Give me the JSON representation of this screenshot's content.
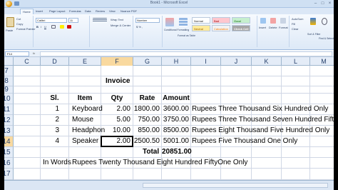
{
  "window": {
    "title": "Book1 - Microsoft Excel"
  },
  "tabs": [
    "Home",
    "Insert",
    "Page Layout",
    "Formulas",
    "Data",
    "Review",
    "View",
    "Nuance PDF"
  ],
  "ribbon": {
    "clipboard": {
      "cut": "Cut",
      "copy": "Copy",
      "format_painter": "Format Painter",
      "paste": "Paste"
    },
    "font": {
      "name": "Calibri",
      "size": "11"
    },
    "alignment": {
      "wrap": "Wrap Text",
      "merge": "Merge & Center"
    },
    "number": {
      "format": "Number"
    },
    "styles": {
      "conditional": "Conditional Formatting",
      "format_table": "Format as Table",
      "normal": "Normal",
      "bad": "Bad",
      "good": "Good",
      "neutral": "Neutral",
      "calculation": "Calculation",
      "check_cell": "Check Cell"
    },
    "cells": {
      "insert": "Insert",
      "delete": "Delete",
      "format": "Format"
    },
    "editing": {
      "autosum": "AutoSum",
      "fill": "Fill",
      "clear": "Clear",
      "sort": "Sort & Filter",
      "find": "Find & Select"
    }
  },
  "formula_bar": {
    "name_box": "F14",
    "fx": "fx"
  },
  "columns": [
    "C",
    "D",
    "E",
    "F",
    "G",
    "H",
    "I",
    "J",
    "K",
    "L",
    "M"
  ],
  "rows": [
    "7",
    "8",
    "9",
    "10",
    "11",
    "12",
    "13",
    "14",
    "15",
    "16",
    "17"
  ],
  "sheet": {
    "title": "Invoice",
    "headers": {
      "sl": "Sl.",
      "item": "Item",
      "qty": "Qty",
      "rate": "Rate",
      "amount": "Amount"
    },
    "items": [
      {
        "sl": "1",
        "item": "Keyboard",
        "qty": "2.00",
        "rate": "1800.00",
        "amount": "3600.00",
        "words": "Rupees Three Thousand Six Hundred  Only"
      },
      {
        "sl": "2",
        "item": "Mouse",
        "qty": "5.00",
        "rate": "750.00",
        "amount": "3750.00",
        "words": "Rupees Three Thousand Seven Hundred Fifty Only"
      },
      {
        "sl": "3",
        "item": "Headphon",
        "qty": "10.00",
        "rate": "850.00",
        "amount": "8500.00",
        "words": "Rupees Eight Thousand Five Hundred  Only"
      },
      {
        "sl": "4",
        "item": "Speaker",
        "qty": "2.00",
        "rate": "2500.50",
        "amount": "5001.00",
        "words": "Rupees Five Thousand One Only"
      }
    ],
    "total_label": "Total",
    "total_value": "20851.00",
    "in_words_label": "In Words",
    "in_words_value": "Rupees Twenty Thousand Eight Hundred FiftyOne Only"
  }
}
